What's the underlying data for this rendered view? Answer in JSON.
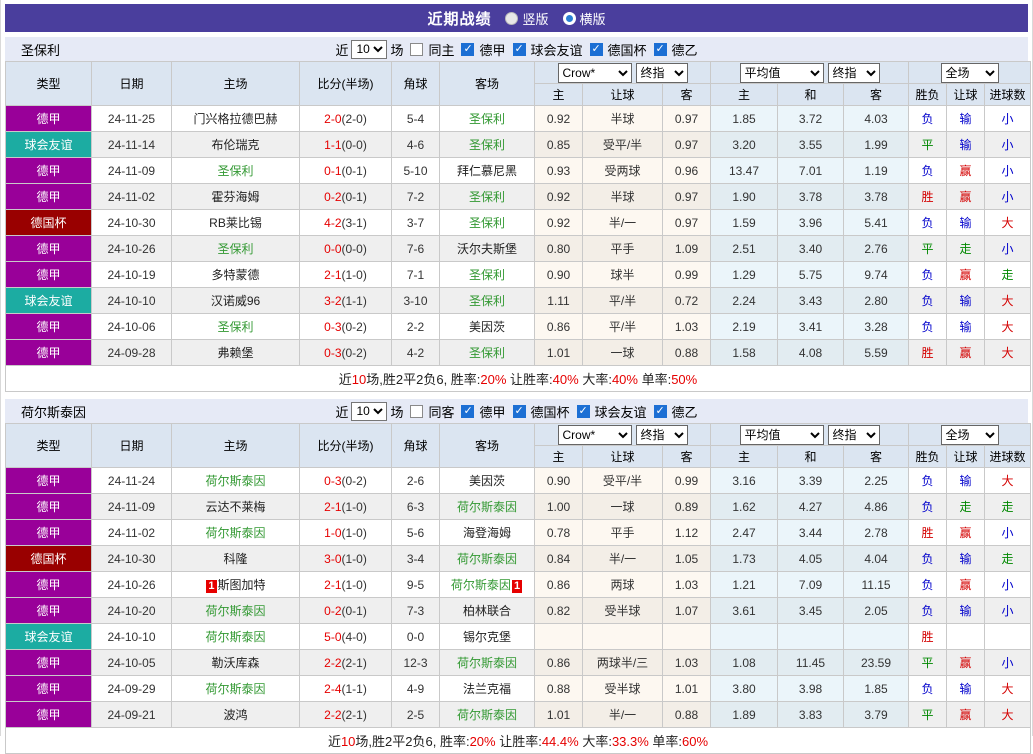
{
  "title_bar": {
    "title": "近期战绩",
    "options": [
      {
        "label": "竖版",
        "selected": false
      },
      {
        "label": "横版",
        "selected": true
      }
    ]
  },
  "controls": {
    "near": "近",
    "count": "10",
    "matches": "场"
  },
  "header": {
    "cols": [
      "类型",
      "日期",
      "主场",
      "比分(半场)",
      "角球",
      "客场"
    ],
    "sub_cols": [
      "主",
      "让球",
      "客",
      "主",
      "和",
      "客",
      "胜负",
      "让球",
      "进球数"
    ],
    "selects": {
      "odds_source": "Crow*",
      "final1": "终指",
      "average": "平均值",
      "final2": "终指",
      "scope": "全场"
    }
  },
  "league_colors": {
    "德甲": "#990099",
    "球会友谊": "#1caca2",
    "德国杯": "#990000"
  },
  "text_colors": {
    "胜": "#d40000",
    "平": "#008800",
    "负": "#0000cc",
    "赢": "#d40000",
    "输": "#0000cc",
    "走": "#008800",
    "大": "#d40000",
    "小": "#0000cc"
  },
  "focal_color": "#339933",
  "sections": [
    {
      "team": "圣保利",
      "same_label": "同主",
      "same_checked": false,
      "leagues": [
        "德甲",
        "球会友谊",
        "德国杯",
        "德乙"
      ],
      "rows": [
        {
          "league": "德甲",
          "date": "24-11-25",
          "home": "门兴格拉德巴赫",
          "home_focal": false,
          "home_redcard": 0,
          "score": "2-0",
          "half": "(2-0)",
          "corners": "5-4",
          "away": "圣保利",
          "away_focal": true,
          "away_redcard": 0,
          "crow_home": "0.92",
          "handicap": "半球",
          "crow_away": "0.97",
          "avg_home": "1.85",
          "avg_draw": "3.72",
          "avg_away": "4.03",
          "result": "负",
          "handicap_result": "输",
          "goals": "小"
        },
        {
          "league": "球会友谊",
          "date": "24-11-14",
          "home": "布伦瑞克",
          "home_focal": false,
          "home_redcard": 0,
          "score": "1-1",
          "half": "(0-0)",
          "corners": "4-6",
          "away": "圣保利",
          "away_focal": true,
          "away_redcard": 0,
          "crow_home": "0.85",
          "handicap": "受平/半",
          "crow_away": "0.97",
          "avg_home": "3.20",
          "avg_draw": "3.55",
          "avg_away": "1.99",
          "result": "平",
          "handicap_result": "输",
          "goals": "小"
        },
        {
          "league": "德甲",
          "date": "24-11-09",
          "home": "圣保利",
          "home_focal": true,
          "home_redcard": 0,
          "score": "0-1",
          "half": "(0-1)",
          "corners": "5-10",
          "away": "拜仁慕尼黑",
          "away_focal": false,
          "away_redcard": 0,
          "crow_home": "0.93",
          "handicap": "受两球",
          "crow_away": "0.96",
          "avg_home": "13.47",
          "avg_draw": "7.01",
          "avg_away": "1.19",
          "result": "负",
          "handicap_result": "赢",
          "goals": "小"
        },
        {
          "league": "德甲",
          "date": "24-11-02",
          "home": "霍芬海姆",
          "home_focal": false,
          "home_redcard": 0,
          "score": "0-2",
          "half": "(0-1)",
          "corners": "7-2",
          "away": "圣保利",
          "away_focal": true,
          "away_redcard": 0,
          "crow_home": "0.92",
          "handicap": "半球",
          "crow_away": "0.97",
          "avg_home": "1.90",
          "avg_draw": "3.78",
          "avg_away": "3.78",
          "result": "胜",
          "handicap_result": "赢",
          "goals": "小"
        },
        {
          "league": "德国杯",
          "date": "24-10-30",
          "home": "RB莱比锡",
          "home_focal": false,
          "home_redcard": 0,
          "score": "4-2",
          "half": "(3-1)",
          "corners": "3-7",
          "away": "圣保利",
          "away_focal": true,
          "away_redcard": 0,
          "crow_home": "0.92",
          "handicap": "半/一",
          "crow_away": "0.97",
          "avg_home": "1.59",
          "avg_draw": "3.96",
          "avg_away": "5.41",
          "result": "负",
          "handicap_result": "输",
          "goals": "大"
        },
        {
          "league": "德甲",
          "date": "24-10-26",
          "home": "圣保利",
          "home_focal": true,
          "home_redcard": 0,
          "score": "0-0",
          "half": "(0-0)",
          "corners": "7-6",
          "away": "沃尔夫斯堡",
          "away_focal": false,
          "away_redcard": 0,
          "crow_home": "0.80",
          "handicap": "平手",
          "crow_away": "1.09",
          "avg_home": "2.51",
          "avg_draw": "3.40",
          "avg_away": "2.76",
          "result": "平",
          "handicap_result": "走",
          "goals": "小"
        },
        {
          "league": "德甲",
          "date": "24-10-19",
          "home": "多特蒙德",
          "home_focal": false,
          "home_redcard": 0,
          "score": "2-1",
          "half": "(1-0)",
          "corners": "7-1",
          "away": "圣保利",
          "away_focal": true,
          "away_redcard": 0,
          "crow_home": "0.90",
          "handicap": "球半",
          "crow_away": "0.99",
          "avg_home": "1.29",
          "avg_draw": "5.75",
          "avg_away": "9.74",
          "result": "负",
          "handicap_result": "赢",
          "goals": "走"
        },
        {
          "league": "球会友谊",
          "date": "24-10-10",
          "home": "汉诺威96",
          "home_focal": false,
          "home_redcard": 0,
          "score": "3-2",
          "half": "(1-1)",
          "corners": "3-10",
          "away": "圣保利",
          "away_focal": true,
          "away_redcard": 0,
          "crow_home": "1.11",
          "handicap": "平/半",
          "crow_away": "0.72",
          "avg_home": "2.24",
          "avg_draw": "3.43",
          "avg_away": "2.80",
          "result": "负",
          "handicap_result": "输",
          "goals": "大"
        },
        {
          "league": "德甲",
          "date": "24-10-06",
          "home": "圣保利",
          "home_focal": true,
          "home_redcard": 0,
          "score": "0-3",
          "half": "(0-2)",
          "corners": "2-2",
          "away": "美因茨",
          "away_focal": false,
          "away_redcard": 0,
          "crow_home": "0.86",
          "handicap": "平/半",
          "crow_away": "1.03",
          "avg_home": "2.19",
          "avg_draw": "3.41",
          "avg_away": "3.28",
          "result": "负",
          "handicap_result": "输",
          "goals": "大"
        },
        {
          "league": "德甲",
          "date": "24-09-28",
          "home": "弗赖堡",
          "home_focal": false,
          "home_redcard": 0,
          "score": "0-3",
          "half": "(0-2)",
          "corners": "4-2",
          "away": "圣保利",
          "away_focal": true,
          "away_redcard": 0,
          "crow_home": "1.01",
          "handicap": "一球",
          "crow_away": "0.88",
          "avg_home": "1.58",
          "avg_draw": "4.08",
          "avg_away": "5.59",
          "result": "胜",
          "handicap_result": "赢",
          "goals": "大"
        }
      ],
      "summary": [
        {
          "text": "近",
          "red": false
        },
        {
          "text": "10",
          "red": true
        },
        {
          "text": "场,胜2平2负6, 胜率:",
          "red": false
        },
        {
          "text": "20%",
          "red": true
        },
        {
          "text": " 让胜率:",
          "red": false
        },
        {
          "text": "40%",
          "red": true
        },
        {
          "text": " 大率:",
          "red": false
        },
        {
          "text": "40%",
          "red": true
        },
        {
          "text": " 单率:",
          "red": false
        },
        {
          "text": "50%",
          "red": true
        }
      ]
    },
    {
      "team": "荷尔斯泰因",
      "same_label": "同客",
      "same_checked": false,
      "leagues": [
        "德甲",
        "德国杯",
        "球会友谊",
        "德乙"
      ],
      "rows": [
        {
          "league": "德甲",
          "date": "24-11-24",
          "home": "荷尔斯泰因",
          "home_focal": true,
          "home_redcard": 0,
          "score": "0-3",
          "half": "(0-2)",
          "corners": "2-6",
          "away": "美因茨",
          "away_focal": false,
          "away_redcard": 0,
          "crow_home": "0.90",
          "handicap": "受平/半",
          "crow_away": "0.99",
          "avg_home": "3.16",
          "avg_draw": "3.39",
          "avg_away": "2.25",
          "result": "负",
          "handicap_result": "输",
          "goals": "大"
        },
        {
          "league": "德甲",
          "date": "24-11-09",
          "home": "云达不莱梅",
          "home_focal": false,
          "home_redcard": 0,
          "score": "2-1",
          "half": "(1-0)",
          "corners": "6-3",
          "away": "荷尔斯泰因",
          "away_focal": true,
          "away_redcard": 0,
          "crow_home": "1.00",
          "handicap": "一球",
          "crow_away": "0.89",
          "avg_home": "1.62",
          "avg_draw": "4.27",
          "avg_away": "4.86",
          "result": "负",
          "handicap_result": "走",
          "goals": "走"
        },
        {
          "league": "德甲",
          "date": "24-11-02",
          "home": "荷尔斯泰因",
          "home_focal": true,
          "home_redcard": 0,
          "score": "1-0",
          "half": "(1-0)",
          "corners": "5-6",
          "away": "海登海姆",
          "away_focal": false,
          "away_redcard": 0,
          "crow_home": "0.78",
          "handicap": "平手",
          "crow_away": "1.12",
          "avg_home": "2.47",
          "avg_draw": "3.44",
          "avg_away": "2.78",
          "result": "胜",
          "handicap_result": "赢",
          "goals": "小"
        },
        {
          "league": "德国杯",
          "date": "24-10-30",
          "home": "科隆",
          "home_focal": false,
          "home_redcard": 0,
          "score": "3-0",
          "half": "(1-0)",
          "corners": "3-4",
          "away": "荷尔斯泰因",
          "away_focal": true,
          "away_redcard": 0,
          "crow_home": "0.84",
          "handicap": "半/一",
          "crow_away": "1.05",
          "avg_home": "1.73",
          "avg_draw": "4.05",
          "avg_away": "4.04",
          "result": "负",
          "handicap_result": "输",
          "goals": "走"
        },
        {
          "league": "德甲",
          "date": "24-10-26",
          "home": "斯图加特",
          "home_focal": false,
          "home_redcard": 1,
          "score": "2-1",
          "half": "(1-0)",
          "corners": "9-5",
          "away": "荷尔斯泰因",
          "away_focal": true,
          "away_redcard": 1,
          "crow_home": "0.86",
          "handicap": "两球",
          "crow_away": "1.03",
          "avg_home": "1.21",
          "avg_draw": "7.09",
          "avg_away": "11.15",
          "result": "负",
          "handicap_result": "赢",
          "goals": "小"
        },
        {
          "league": "德甲",
          "date": "24-10-20",
          "home": "荷尔斯泰因",
          "home_focal": true,
          "home_redcard": 0,
          "score": "0-2",
          "half": "(0-1)",
          "corners": "7-3",
          "away": "柏林联合",
          "away_focal": false,
          "away_redcard": 0,
          "crow_home": "0.82",
          "handicap": "受半球",
          "crow_away": "1.07",
          "avg_home": "3.61",
          "avg_draw": "3.45",
          "avg_away": "2.05",
          "result": "负",
          "handicap_result": "输",
          "goals": "小"
        },
        {
          "league": "球会友谊",
          "date": "24-10-10",
          "home": "荷尔斯泰因",
          "home_focal": true,
          "home_redcard": 0,
          "score": "5-0",
          "half": "(4-0)",
          "corners": "0-0",
          "away": "锡尔克堡",
          "away_focal": false,
          "away_redcard": 0,
          "crow_home": "",
          "handicap": "",
          "crow_away": "",
          "avg_home": "",
          "avg_draw": "",
          "avg_away": "",
          "result": "胜",
          "handicap_result": "",
          "goals": ""
        },
        {
          "league": "德甲",
          "date": "24-10-05",
          "home": "勒沃库森",
          "home_focal": false,
          "home_redcard": 0,
          "score": "2-2",
          "half": "(2-1)",
          "corners": "12-3",
          "away": "荷尔斯泰因",
          "away_focal": true,
          "away_redcard": 0,
          "crow_home": "0.86",
          "handicap": "两球半/三",
          "crow_away": "1.03",
          "avg_home": "1.08",
          "avg_draw": "11.45",
          "avg_away": "23.59",
          "result": "平",
          "handicap_result": "赢",
          "goals": "小"
        },
        {
          "league": "德甲",
          "date": "24-09-29",
          "home": "荷尔斯泰因",
          "home_focal": true,
          "home_redcard": 0,
          "score": "2-4",
          "half": "(1-1)",
          "corners": "4-9",
          "away": "法兰克福",
          "away_focal": false,
          "away_redcard": 0,
          "crow_home": "0.88",
          "handicap": "受半球",
          "crow_away": "1.01",
          "avg_home": "3.80",
          "avg_draw": "3.98",
          "avg_away": "1.85",
          "result": "负",
          "handicap_result": "输",
          "goals": "大"
        },
        {
          "league": "德甲",
          "date": "24-09-21",
          "home": "波鸿",
          "home_focal": false,
          "home_redcard": 0,
          "score": "2-2",
          "half": "(2-1)",
          "corners": "2-5",
          "away": "荷尔斯泰因",
          "away_focal": true,
          "away_redcard": 0,
          "crow_home": "1.01",
          "handicap": "半/一",
          "crow_away": "0.88",
          "avg_home": "1.89",
          "avg_draw": "3.83",
          "avg_away": "3.79",
          "result": "平",
          "handicap_result": "赢",
          "goals": "大"
        }
      ],
      "summary": [
        {
          "text": "近",
          "red": false
        },
        {
          "text": "10",
          "red": true
        },
        {
          "text": "场,胜2平2负6, 胜率:",
          "red": false
        },
        {
          "text": "20%",
          "red": true
        },
        {
          "text": " 让胜率:",
          "red": false
        },
        {
          "text": "44.4%",
          "red": true
        },
        {
          "text": " 大率:",
          "red": false
        },
        {
          "text": "33.3%",
          "red": true
        },
        {
          "text": " 单率:",
          "red": false
        },
        {
          "text": "60%",
          "red": true
        }
      ]
    }
  ]
}
